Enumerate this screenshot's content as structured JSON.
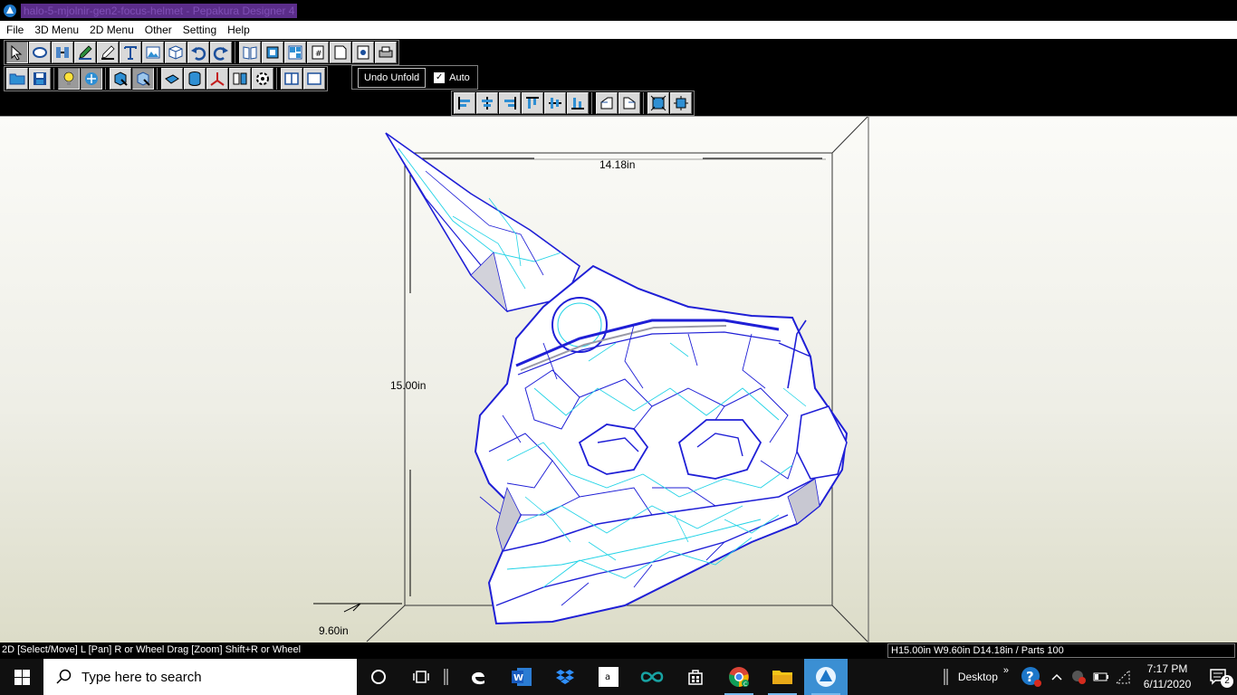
{
  "window": {
    "title": "halo-5-mjolnir-gen2-focus-helmet - Pepakura Designer 4"
  },
  "menu": {
    "items": [
      "File",
      "3D Menu",
      "2D Menu",
      "Other",
      "Setting",
      "Help"
    ]
  },
  "toolbar": {
    "undo_unfold_label": "Undo Unfold",
    "auto_label": "Auto",
    "auto_checked": true
  },
  "viewport": {
    "dimensions": {
      "depth_label": "14.18in",
      "height_label": "15.00in",
      "width_label": "9.60in"
    }
  },
  "status": {
    "hint": "2D [Select/Move] L [Pan] R or Wheel Drag [Zoom] Shift+R or Wheel",
    "info": "H15.00in W9.60in D14.18in / Parts 100"
  },
  "taskbar": {
    "search_placeholder": "Type here to search",
    "desktop_label": "Desktop",
    "time": "7:17 PM",
    "date": "6/11/2020",
    "notification_count": "2",
    "chevron": "»"
  },
  "colors": {
    "edge_dark": "#1f1fd6",
    "edge_light": "#22d3e6",
    "background": "#eeeee6"
  }
}
